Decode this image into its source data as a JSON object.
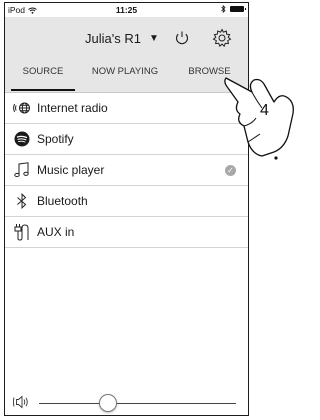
{
  "status_bar": {
    "carrier": "iPod",
    "time": "11:25"
  },
  "header": {
    "device_name": "Julia's R1"
  },
  "tabs": [
    {
      "label": "SOURCE",
      "active": true
    },
    {
      "label": "NOW PLAYING",
      "active": false
    },
    {
      "label": "BROWSE",
      "active": false
    }
  ],
  "sources": [
    {
      "label": "Internet radio",
      "icon": "internet-radio-icon"
    },
    {
      "label": "Spotify",
      "icon": "spotify-icon"
    },
    {
      "label": "Music player",
      "icon": "music-note-icon",
      "selected": true
    },
    {
      "label": "Bluetooth",
      "icon": "bluetooth-icon"
    },
    {
      "label": "AUX in",
      "icon": "aux-cable-icon"
    }
  ],
  "volume": {
    "level": 0.35
  },
  "callout": {
    "number": "4"
  }
}
